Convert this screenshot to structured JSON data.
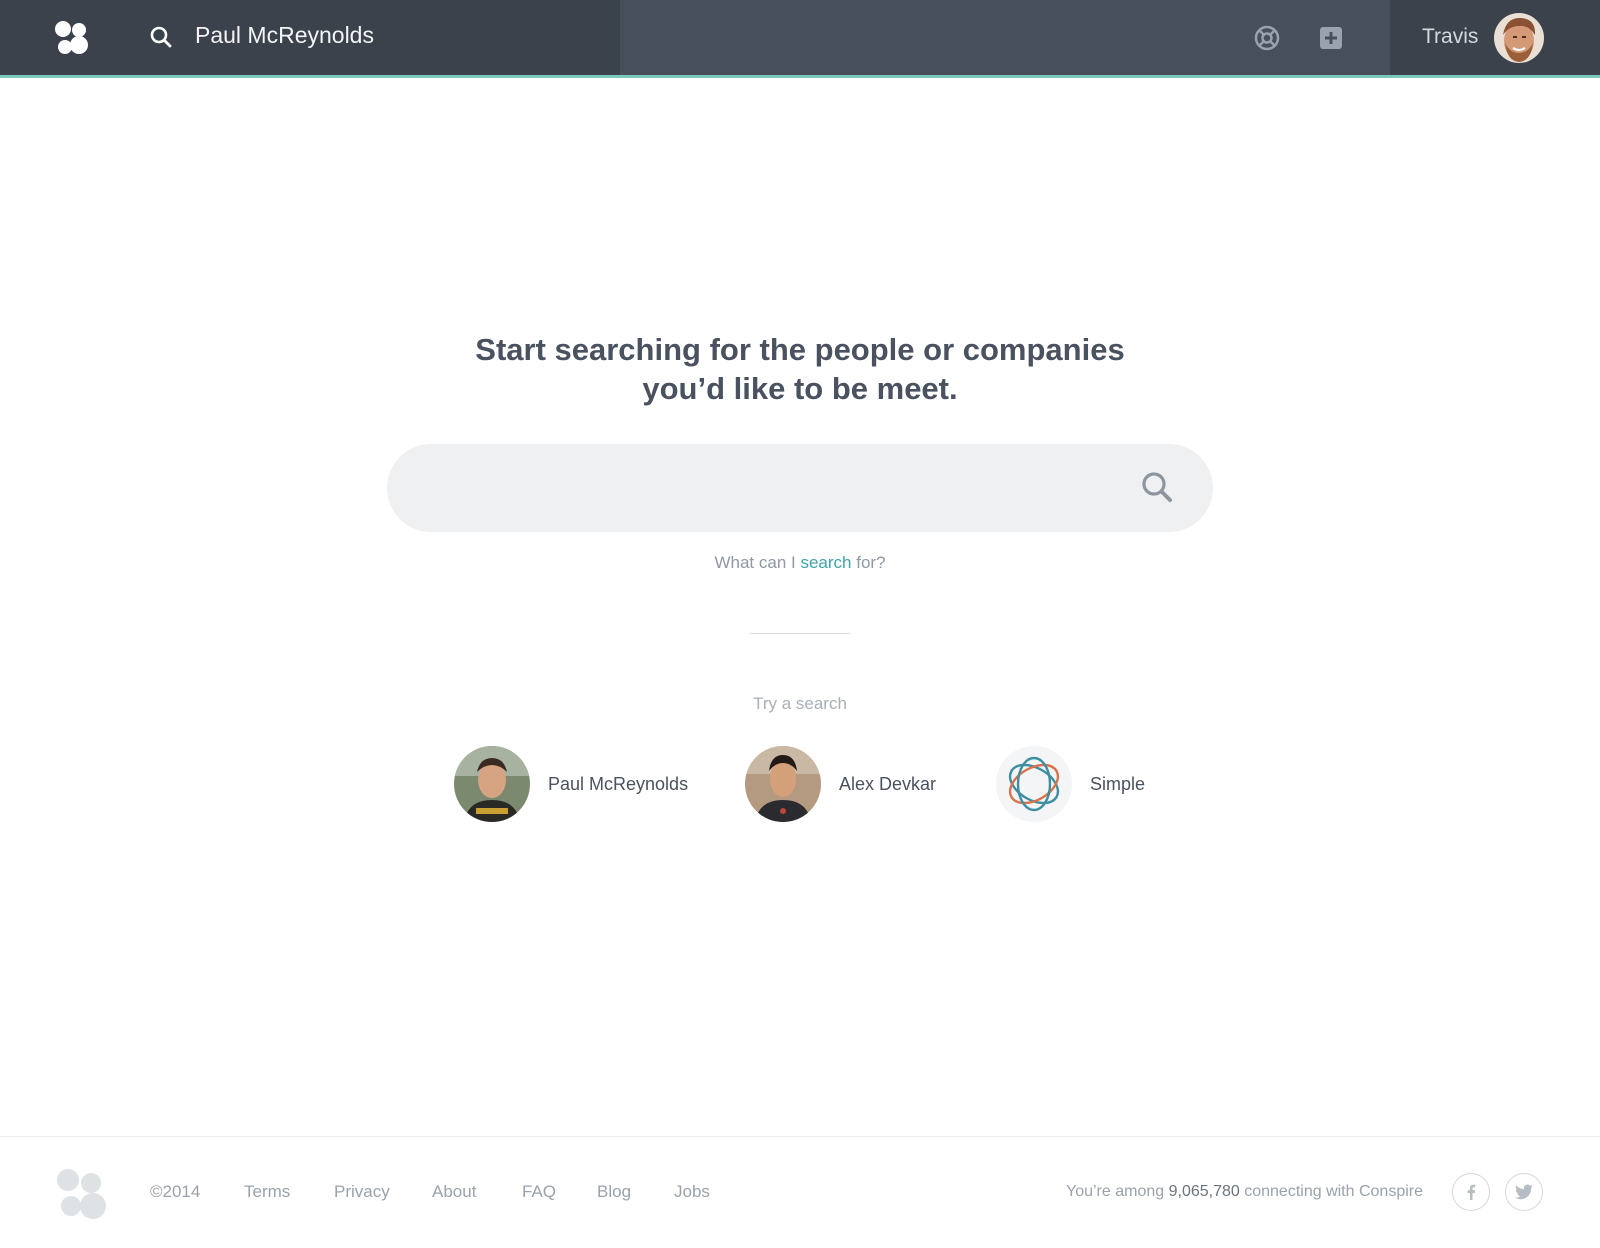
{
  "header": {
    "search_query": "Paul McReynolds",
    "user_name": "Travis",
    "icons": [
      "logo-icon",
      "search-icon",
      "help-icon",
      "plus-icon"
    ],
    "accent_color": "#79ccbc"
  },
  "main": {
    "headline_line1": "Start searching for the people or companies",
    "headline_line2": "you’d like to be meet.",
    "search_placeholder": "",
    "help_prefix": "What can I",
    "help_link": "search",
    "help_suffix": "for?",
    "try_label": "Try a search",
    "suggestions": [
      {
        "label": "Paul McReynolds",
        "kind": "person"
      },
      {
        "label": "Alex Devkar",
        "kind": "person"
      },
      {
        "label": "Simple",
        "kind": "company"
      }
    ],
    "link_color": "#3fa3a8"
  },
  "footer": {
    "copyright": "©2014",
    "links": [
      "Terms",
      "Privacy",
      "About",
      "FAQ",
      "Blog",
      "Jobs"
    ],
    "stat_prefix": "You’re among",
    "stat_count": "9,065,780",
    "stat_suffix": "connecting with Conspire",
    "social": [
      "facebook-icon",
      "twitter-icon"
    ]
  }
}
